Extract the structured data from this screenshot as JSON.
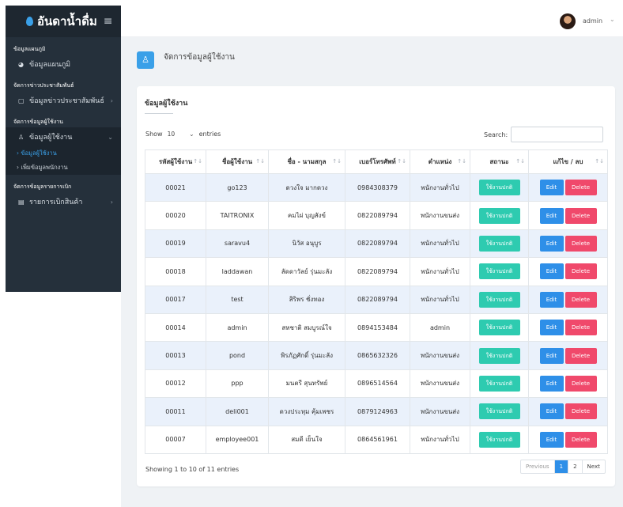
{
  "brand": {
    "title": "อันดาน้ำดื่ม"
  },
  "sidebar": {
    "sections": [
      {
        "label": "ข้อมูลแผนภูมิ",
        "items": [
          {
            "label": "ข้อมูลแผนภูมิ"
          }
        ]
      },
      {
        "label": "จัดการข่าวประชาสัมพันธ์",
        "items": [
          {
            "label": "ข้อมูลข่าวประชาสัมพันธ์"
          }
        ]
      },
      {
        "label": "จัดการข้อมูลผู้ใช้งาน",
        "items": [
          {
            "label": "ข้อมูลผู้ใช้งาน"
          }
        ],
        "subitems": [
          {
            "label": "› ข้อมูลผู้ใช้งาน"
          },
          {
            "label": "› เพิ่มข้อมูลพนักงาน"
          }
        ]
      },
      {
        "label": "จัดการข้อมูลรายการเบิก",
        "items": [
          {
            "label": "รายการเบิกสินค้า"
          }
        ]
      }
    ]
  },
  "topbar": {
    "user_name": "admin"
  },
  "page": {
    "title": "จัดการข้อมูลผู้ใช้งาน"
  },
  "card": {
    "title": "ข้อมูลผู้ใช้งาน"
  },
  "table_controls": {
    "show_label": "Show",
    "length_value": "10",
    "entries_label": "entries",
    "search_label": "Search:",
    "search_value": ""
  },
  "columns": [
    "รหัสผู้ใช้งาน",
    "ชื่อผู้ใช้งาน",
    "ชื่อ - นามสกุล",
    "เบอร์โทรศัพท์",
    "ตำแหน่ง",
    "สถานะ",
    "แก้ไข / ลบ"
  ],
  "rows": [
    {
      "id": "00021",
      "username": "go123",
      "fullname": "ดวงใจ มากดวง",
      "phone": "0984308379",
      "position": "พนักงานทั่วไป",
      "status": "ใช้งานปกติ",
      "edit": "Edit",
      "delete": "Delete"
    },
    {
      "id": "00020",
      "username": "TAITRONIX",
      "fullname": "คมไผ่ บุญสังข์",
      "phone": "0822089794",
      "position": "พนักงานขนส่ง",
      "status": "ใช้งานปกติ",
      "edit": "Edit",
      "delete": "Delete"
    },
    {
      "id": "00019",
      "username": "saravu4",
      "fullname": "นิวัส อนุบูร",
      "phone": "0822089794",
      "position": "พนักงานทั่วไป",
      "status": "ใช้งานปกติ",
      "edit": "Edit",
      "delete": "Delete"
    },
    {
      "id": "00018",
      "username": "laddawan",
      "fullname": "ลัดดาวัลย์ รุ่นมะลัง",
      "phone": "0822089794",
      "position": "พนักงานทั่วไป",
      "status": "ใช้งานปกติ",
      "edit": "Edit",
      "delete": "Delete"
    },
    {
      "id": "00017",
      "username": "test",
      "fullname": "สิริพร ชั่งทอง",
      "phone": "0822089794",
      "position": "พนักงานทั่วไป",
      "status": "ใช้งานปกติ",
      "edit": "Edit",
      "delete": "Delete"
    },
    {
      "id": "00014",
      "username": "admin",
      "fullname": "สหชาติ สมบูรณ์ใจ",
      "phone": "0894153484",
      "position": "admin",
      "status": "ใช้งานปกติ",
      "edit": "Edit",
      "delete": "Delete"
    },
    {
      "id": "00013",
      "username": "pond",
      "fullname": "พิรภัฏศักดิ์ รุ่นมะลัง",
      "phone": "0865632326",
      "position": "พนักงานขนส่ง",
      "status": "ใช้งานปกติ",
      "edit": "Edit",
      "delete": "Delete"
    },
    {
      "id": "00012",
      "username": "ppp",
      "fullname": "มนตรี สุนทรัพย์",
      "phone": "0896514564",
      "position": "พนักงานขนส่ง",
      "status": "ใช้งานปกติ",
      "edit": "Edit",
      "delete": "Delete"
    },
    {
      "id": "00011",
      "username": "deli001",
      "fullname": "ดวงประทุม คุ้มเพชร",
      "phone": "0879124963",
      "position": "พนักงานขนส่ง",
      "status": "ใช้งานปกติ",
      "edit": "Edit",
      "delete": "Delete"
    },
    {
      "id": "00007",
      "username": "employee001",
      "fullname": "สมดี เย็นใจ",
      "phone": "0864561961",
      "position": "พนักงานทั่วไป",
      "status": "ใช้งานปกติ",
      "edit": "Edit",
      "delete": "Delete"
    }
  ],
  "footer": {
    "info": "Showing 1 to 10 of 11 entries",
    "previous": "Previous",
    "pages": [
      "1",
      "2"
    ],
    "next": "Next"
  }
}
